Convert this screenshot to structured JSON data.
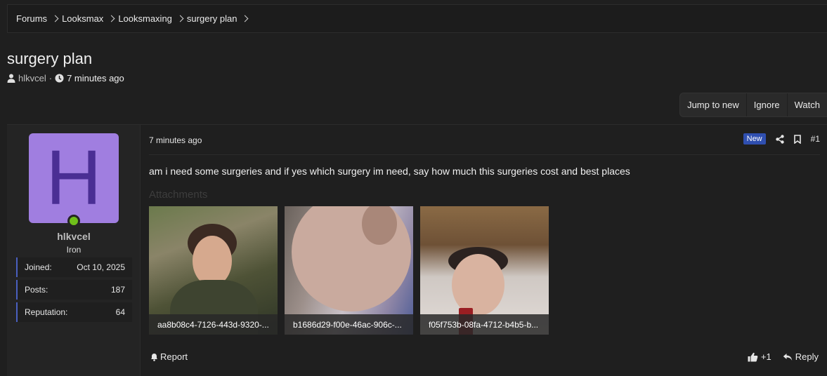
{
  "breadcrumb": [
    "Forums",
    "Looksmax",
    "Looksmaxing",
    "surgery plan"
  ],
  "thread": {
    "title": "surgery plan",
    "author": "hlkvcel",
    "separator": "·",
    "time": "7 minutes ago"
  },
  "buttons": {
    "jump_to_new": "Jump to new",
    "ignore": "Ignore",
    "watch": "Watch"
  },
  "user": {
    "avatar_letter": "H",
    "name": "hlkvcel",
    "title": "Iron",
    "stats": [
      {
        "label": "Joined:",
        "value": "Oct 10, 2025"
      },
      {
        "label": "Posts:",
        "value": "187"
      },
      {
        "label": "Reputation:",
        "value": "64"
      }
    ]
  },
  "post": {
    "time": "7 minutes ago",
    "badge": "New",
    "number": "#1",
    "body": "am i need some surgeries and if yes which surgery im need, say how much this surgeries cost and best places",
    "attachments_title": "Attachments",
    "attachments": [
      {
        "caption": "aa8b08c4-7126-443d-9320-..."
      },
      {
        "caption": "b1686d29-f00e-46ac-906c-..."
      },
      {
        "caption": "f05f753b-08fa-4712-b4b5-b..."
      }
    ],
    "report": "Report",
    "reactions": "+1",
    "reply": "Reply"
  },
  "colors": {
    "background": "#1f1f1f",
    "avatar_bg": "#a07ee0",
    "avatar_letter": "#4a2e94",
    "online": "#6fbf1a",
    "accent": "#2f4fb0",
    "stat_border": "#4a5fbf"
  }
}
